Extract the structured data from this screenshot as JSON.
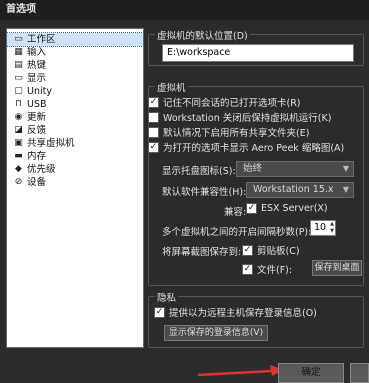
{
  "window": {
    "title": "首选项"
  },
  "sidebar": {
    "items": [
      {
        "label": "工作区",
        "icon": "workspace-icon",
        "glyph": "▭",
        "selected": true
      },
      {
        "label": "输入",
        "icon": "input-icon",
        "glyph": "▦"
      },
      {
        "label": "热键",
        "icon": "hotkeys-icon",
        "glyph": "▤"
      },
      {
        "label": "显示",
        "icon": "display-icon",
        "glyph": "▭"
      },
      {
        "label": "Unity",
        "icon": "unity-icon",
        "glyph": "▢"
      },
      {
        "label": "USB",
        "icon": "usb-icon",
        "glyph": "⊓"
      },
      {
        "label": "更新",
        "icon": "update-icon",
        "glyph": "◉"
      },
      {
        "label": "反馈",
        "icon": "feedback-icon",
        "glyph": "◪"
      },
      {
        "label": "共享虚拟机",
        "icon": "shared-vm-icon",
        "glyph": "▣"
      },
      {
        "label": "内存",
        "icon": "memory-icon",
        "glyph": "▬"
      },
      {
        "label": "优先级",
        "icon": "priority-icon",
        "glyph": "◆"
      },
      {
        "label": "设备",
        "icon": "devices-icon",
        "glyph": "⊘"
      }
    ]
  },
  "location": {
    "group_title": "虚拟机的默认位置(D)",
    "path_value": "E:\\workspace"
  },
  "vm": {
    "group_title": "虚拟机",
    "cb_remember_tabs": "记住不同会话的已打开选项卡(R)",
    "cb_keep_running": "Workstation 关闭后保持虚拟机运行(K)",
    "cb_show_shared": "默认情况下启用所有共享文件夹(E)",
    "cb_aero_peek": "为打开的选项卡显示 Aero Peek 缩略图(A)",
    "tray_label": "显示托盘图标(S):",
    "tray_value": "始终",
    "compat_label": "默认软件兼容性(H):",
    "compat_value": "Workstation 15.x",
    "esx_label": "兼容:",
    "esx_option": "ESX Server(X)",
    "interval_label": "多个虚拟机之间的开启间隔秒数(P):",
    "interval_value": "10",
    "save_label": "将屏幕截图保存到:",
    "cb_clipboard": "剪贴板(C)",
    "cb_file": "文件(F):",
    "save_location": "保存到桌面"
  },
  "privacy": {
    "group_title": "隐私",
    "cb_save_login": "提供以为远程主机保存登录信息(O)",
    "show_saved_button": "显示保存的登录信息(V)"
  },
  "footer": {
    "ok_label": "确定"
  },
  "colors": {
    "accent_arrow": "#e03030"
  }
}
